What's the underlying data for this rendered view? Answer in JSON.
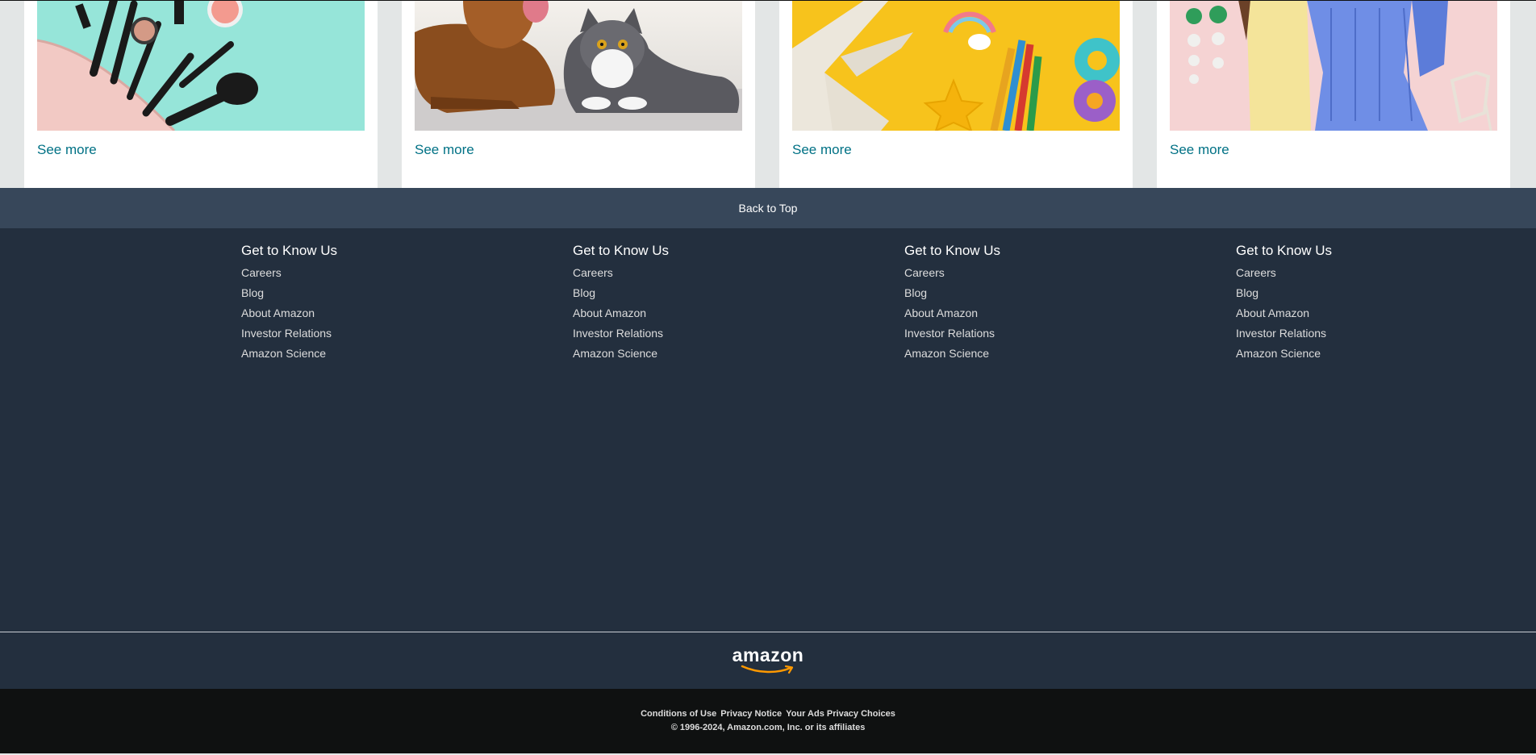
{
  "cards": [
    {
      "link": "See more",
      "image": "makeup-flatlay-image"
    },
    {
      "link": "See more",
      "image": "dog-and-cat-image"
    },
    {
      "link": "See more",
      "image": "kids-toys-and-pencils-image"
    },
    {
      "link": "See more",
      "image": "fashion-outfit-image"
    }
  ],
  "back_to_top": "Back to Top",
  "footer": {
    "columns": [
      {
        "heading": "Get to Know Us",
        "links": [
          "Careers",
          "Blog",
          "About Amazon",
          "Investor Relations",
          "Amazon Science"
        ]
      },
      {
        "heading": "Get to Know Us",
        "links": [
          "Careers",
          "Blog",
          "About Amazon",
          "Investor Relations",
          "Amazon Science"
        ]
      },
      {
        "heading": "Get to Know Us",
        "links": [
          "Careers",
          "Blog",
          "About Amazon",
          "Investor Relations",
          "Amazon Science"
        ]
      },
      {
        "heading": "Get to Know Us",
        "links": [
          "Careers",
          "Blog",
          "About Amazon",
          "Investor Relations",
          "Amazon Science"
        ]
      }
    ],
    "logo": "amazon",
    "legal_links": [
      "Conditions of Use",
      "Privacy Notice",
      "Your Ads Privacy Choices"
    ],
    "copyright": "© 1996-2024, Amazon.com, Inc. or its affiliates"
  },
  "colors": {
    "page_bg": "#e3e6e6",
    "link": "#007185",
    "back_to_top_bg": "#37475a",
    "footer_bg": "#232f3e",
    "bottom_bg": "#0f1111",
    "smile_orange": "#ff9900"
  }
}
